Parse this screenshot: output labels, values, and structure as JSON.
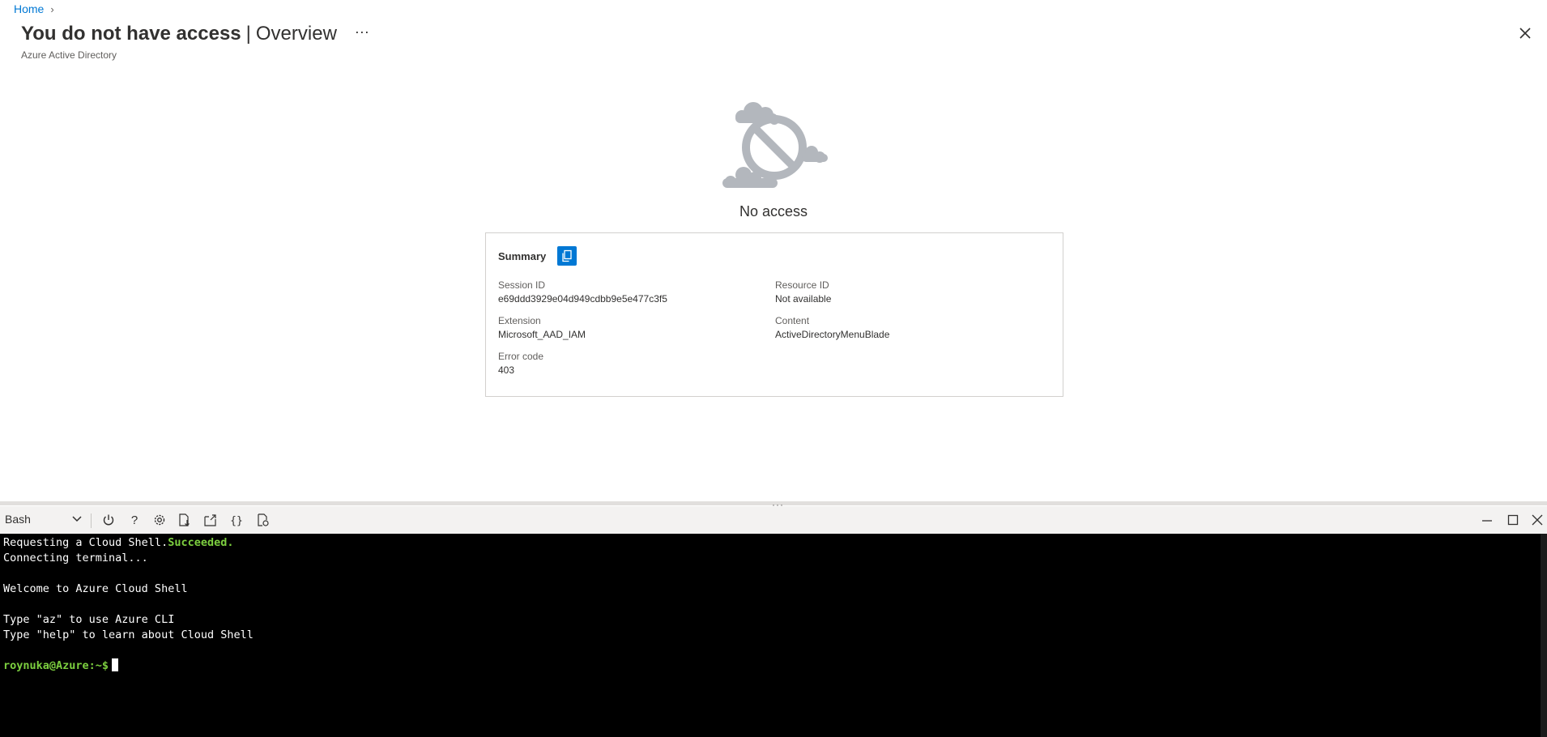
{
  "header": {
    "breadcrumb": {
      "home": "Home"
    },
    "title_main": "You do not have access",
    "title_separator": "|",
    "title_sub": "Overview",
    "more": "···",
    "subtitle": "Azure Active Directory"
  },
  "content": {
    "illustration_icon": "cloud-no-access-icon",
    "message": "No access"
  },
  "summary": {
    "title": "Summary",
    "fields": [
      {
        "label": "Session ID",
        "value": "e69ddd3929e04d949cdbb9e5e477c3f5"
      },
      {
        "label": "Resource ID",
        "value": "Not available"
      },
      {
        "label": "Extension",
        "value": "Microsoft_AAD_IAM"
      },
      {
        "label": "Content",
        "value": "ActiveDirectoryMenuBlade"
      },
      {
        "label": "Error code",
        "value": "403"
      }
    ]
  },
  "shell": {
    "selected": "Bash",
    "toolbar_icons": [
      "power-icon",
      "help-icon",
      "settings-icon",
      "upload-download-icon",
      "open-new-session-icon",
      "editor-braces-icon",
      "web-preview-icon"
    ],
    "window_icons": [
      "minimize-icon",
      "maximize-icon",
      "close-icon"
    ]
  },
  "terminal": {
    "line1_prefix": "Requesting a Cloud Shell.",
    "line1_status": "Succeeded.",
    "line2": "Connecting terminal...",
    "line3": "",
    "line4": "Welcome to Azure Cloud Shell",
    "line5": "",
    "line6": "Type \"az\" to use Azure CLI",
    "line7": "Type \"help\" to learn about Cloud Shell",
    "line8": "",
    "prompt": "roynuka@Azure:~$"
  },
  "colors": {
    "accent": "#0078d4",
    "terminal_bg": "#000000",
    "terminal_green": "#7ccf3f"
  }
}
